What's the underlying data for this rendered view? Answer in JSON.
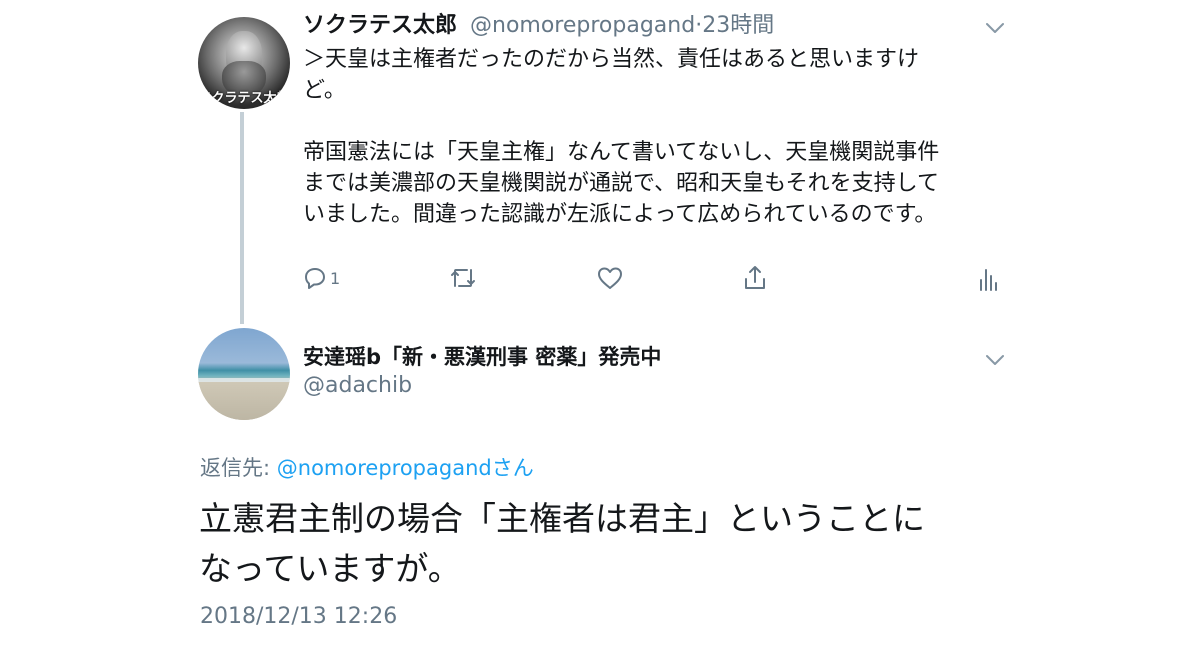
{
  "tweet1": {
    "display_name": "ソクラテス太郎",
    "handle": "@nomorepropagand",
    "dot": "·",
    "time": "23時間",
    "avatar_overlay_text": "ソクラテス太郎",
    "body_lines": [
      "＞天皇は主権者だったのだから当然、責任はあると思いますけ",
      "ど。",
      "",
      "帝国憲法には「天皇主権」なんて書いてないし、天皇機関説事件",
      "までは美濃部の天皇機関説が通説で、昭和天皇もそれを支持して",
      "いました。間違った認識が左派によって広められているのです。"
    ],
    "reply_count": "1",
    "icons": {
      "reply": "reply-icon",
      "retweet": "retweet-icon",
      "like": "heart-icon",
      "share": "share-icon",
      "analytics": "analytics-icon",
      "menu": "chevron-down-icon"
    }
  },
  "tweet2": {
    "display_name": "安達瑶b「新・悪漢刑事 密薬」発売中",
    "handle": "@adachib",
    "reply_prefix": "返信先: ",
    "reply_mention": "@nomorepropagand",
    "reply_suffix": "さん",
    "text_lines": [
      "立憲君主制の場合「主権者は君主」ということに",
      "なっていますが。"
    ],
    "timestamp": "2018/12/13 12:26"
  },
  "colors": {
    "text": "#14171a",
    "secondary": "#657786",
    "link": "#1da1f2",
    "thread_line": "#c4cfd6"
  }
}
